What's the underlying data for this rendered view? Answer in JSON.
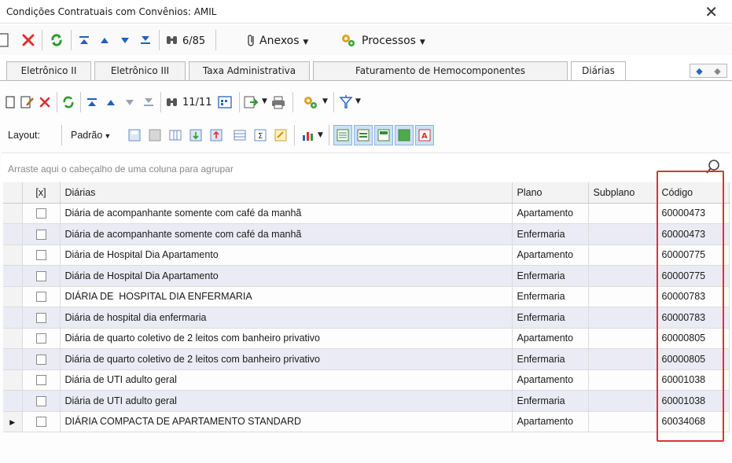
{
  "window": {
    "title": "Condições Contratuais com Convênios: AMIL"
  },
  "main_toolbar": {
    "record_counter": "6/85",
    "attachments_label": "Anexos",
    "processes_label": "Processos"
  },
  "tabs": [
    {
      "label": "Eletrônico II"
    },
    {
      "label": "Eletrônico III"
    },
    {
      "label": "Taxa Administrativa"
    },
    {
      "label": "Faturamento de Hemocomponentes"
    },
    {
      "label": "Diárias",
      "active": true
    }
  ],
  "sub_toolbar": {
    "record_counter": "11/11"
  },
  "layout_bar": {
    "layout_label": "Layout:",
    "default_label": "Padrão"
  },
  "group_panel": {
    "hint": "Arraste aqui o cabeçalho de uma coluna para agrupar"
  },
  "grid": {
    "columns": [
      "[x]",
      "Diárias",
      "Plano",
      "Subplano",
      "Código"
    ],
    "rows": [
      {
        "description": "Diária de acompanhante somente com café da manhã",
        "plan": "Apartamento",
        "subplan": "",
        "code": "60000473"
      },
      {
        "description": "Diária de acompanhante somente com café da manhã",
        "plan": "Enfermaria",
        "subplan": "",
        "code": "60000473"
      },
      {
        "description": "Diária de Hospital Dia Apartamento",
        "plan": "Apartamento",
        "subplan": "",
        "code": "60000775"
      },
      {
        "description": "Diária de Hospital Dia Apartamento",
        "plan": "Enfermaria",
        "subplan": "",
        "code": "60000775"
      },
      {
        "description": "DIÁRIA DE  HOSPITAL DIA ENFERMARIA",
        "plan": "Enfermaria",
        "subplan": "",
        "code": "60000783"
      },
      {
        "description": "Diária de hospital dia enfermaria",
        "plan": "Enfermaria",
        "subplan": "",
        "code": "60000783"
      },
      {
        "description": "Diária de quarto coletivo de 2 leitos com banheiro privativo",
        "plan": "Apartamento",
        "subplan": "",
        "code": "60000805"
      },
      {
        "description": "Diária de quarto coletivo de 2 leitos com banheiro privativo",
        "plan": "Enfermaria",
        "subplan": "",
        "code": "60000805"
      },
      {
        "description": "Diária de UTI adulto geral",
        "plan": "Apartamento",
        "subplan": "",
        "code": "60001038"
      },
      {
        "description": "Diária de UTI adulto geral",
        "plan": "Enfermaria",
        "subplan": "",
        "code": "60001038"
      },
      {
        "description": "DIÁRIA COMPACTA DE APARTAMENTO STANDARD",
        "plan": "Apartamento",
        "subplan": "",
        "code": "60034068",
        "current": true
      }
    ]
  },
  "colors": {
    "highlight": "#d9333a",
    "alt_row": "#ebebf5",
    "delete_red": "#e03030",
    "refresh_green": "#2e9a2e",
    "nav_blue": "#1f5fc0"
  }
}
